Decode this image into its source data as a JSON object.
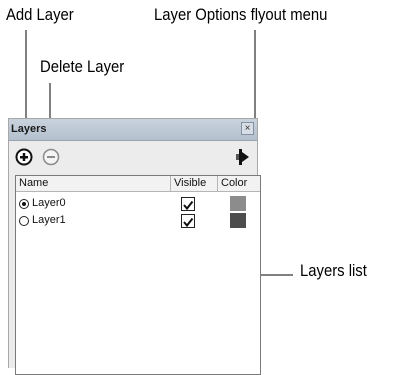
{
  "callouts": {
    "add_layer": "Add Layer",
    "layer_options": "Layer Options flyout menu",
    "delete_layer": "Delete Layer",
    "layers_list": "Layers list"
  },
  "panel": {
    "title": "Layers",
    "close_glyph": "×",
    "toolbar": {
      "add_icon": "plus-circle-icon",
      "delete_icon": "minus-circle-icon",
      "flyout_icon": "flyout-arrow-icon"
    },
    "columns": {
      "name": "Name",
      "visible": "Visible",
      "color": "Color"
    },
    "layers": [
      {
        "name": "Layer0",
        "active": true,
        "visible": true,
        "color": "#8c8c8c"
      },
      {
        "name": "Layer1",
        "active": false,
        "visible": true,
        "color": "#4d4d4d"
      }
    ]
  }
}
